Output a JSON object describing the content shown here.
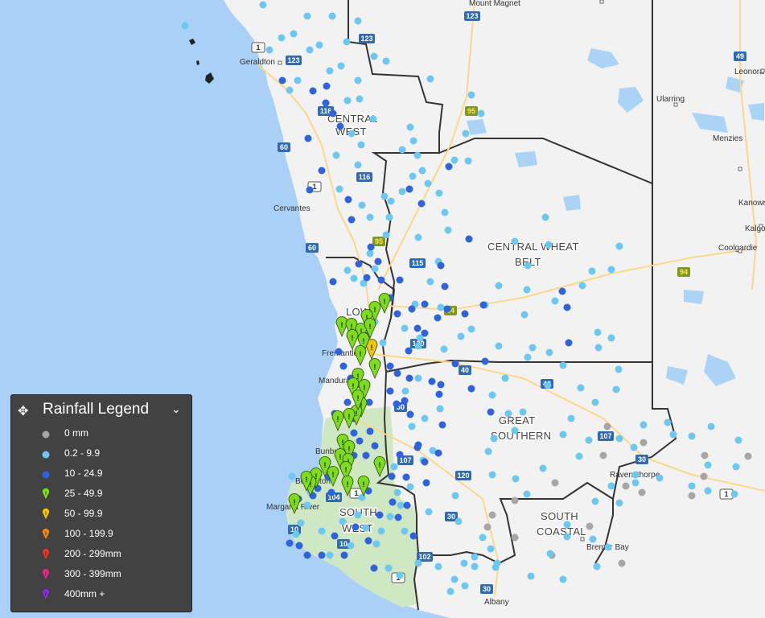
{
  "legend": {
    "title": "Rainfall Legend",
    "move_icon": "move-icon",
    "collapse_icon": "chevron-down-icon",
    "items": [
      {
        "label": "0 mm",
        "color": "#a6a6a6",
        "icon": "dot-marker-icon"
      },
      {
        "label": "0.2 - 9.9",
        "color": "#6cc8f0",
        "icon": "dot-marker-icon"
      },
      {
        "label": "10 - 24.9",
        "color": "#2f63de",
        "icon": "dot-marker-icon"
      },
      {
        "label": "25 - 49.9",
        "color": "#7ddc1f",
        "icon": "pin-marker-icon"
      },
      {
        "label": "50 - 99.9",
        "color": "#f2c30d",
        "icon": "pin-marker-icon"
      },
      {
        "label": "100 - 199.9",
        "color": "#f0861a",
        "icon": "pin-marker-icon"
      },
      {
        "label": "200 - 299mm",
        "color": "#e8342a",
        "icon": "pin-marker-icon"
      },
      {
        "label": "300 - 399mm",
        "color": "#e0298e",
        "icon": "pin-marker-icon"
      },
      {
        "label": "400mm +",
        "color": "#8a2be2",
        "icon": "pin-marker-icon"
      }
    ]
  },
  "regions": [
    "CENTRAL WEST",
    "CENTRAL WHEAT BELT",
    "LOWER",
    "GREAT SOUTHERN",
    "SOUTH WEST",
    "SOUTH COASTAL"
  ],
  "towns": [
    "Mount Magnet",
    "Geraldton",
    "Leonora",
    "Ularring",
    "Menzies",
    "Cervantes",
    "Kanowna",
    "Kalgoorlie",
    "Coolgardie",
    "Fremantle",
    "Mandurah",
    "Bunbury",
    "Busselton",
    "Margaret River",
    "Ravensthorpe",
    "Bremer Bay",
    "Albany"
  ],
  "roads": [
    "123",
    "123",
    "123",
    "1",
    "116",
    "116",
    "60",
    "1",
    "95",
    "95",
    "60",
    "115",
    "94",
    "94",
    "120",
    "40",
    "40",
    "30",
    "107",
    "107",
    "120",
    "30",
    "104",
    "10",
    "1",
    "10",
    "102",
    "30",
    "49",
    "30",
    "1",
    "1"
  ]
}
